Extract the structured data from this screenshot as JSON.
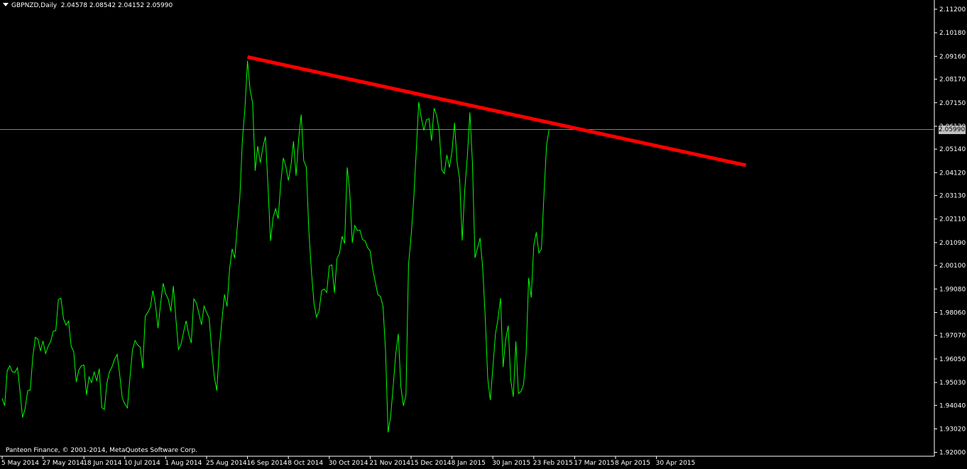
{
  "header": {
    "symbol": "GBPNZD,Daily",
    "ohlc": "2.04578 2.08542 2.04152 2.05990"
  },
  "copyright": "Panteon Finance, © 2001-2014, MetaQuotes Software Corp.",
  "current_price_label": "2.05990",
  "colors": {
    "background": "#000000",
    "price_line": "#00ff00",
    "trend_line": "#ff0000",
    "axis": "#ffffff",
    "current_price_line": "#808080"
  },
  "chart_data": {
    "type": "line",
    "title": "",
    "xlabel": "",
    "ylabel": "",
    "ylim": [
      1.9202,
      2.112
    ],
    "grid": false,
    "y_ticks": [
      "2.11200",
      "2.10180",
      "2.09160",
      "2.08170",
      "2.07150",
      "2.06130",
      "2.05140",
      "2.04120",
      "2.03130",
      "2.02110",
      "2.01090",
      "2.00100",
      "1.99080",
      "1.98060",
      "1.97070",
      "1.96050",
      "1.95030",
      "1.94040",
      "1.93020",
      "1.92000"
    ],
    "x_labels": [
      {
        "label": "5 May 2014",
        "x": 0
      },
      {
        "label": "27 May 2014",
        "x": 16
      },
      {
        "label": "18 Jun 2014",
        "x": 32
      },
      {
        "label": "10 Jul 2014",
        "x": 48
      },
      {
        "label": "1 Aug 2014",
        "x": 64
      },
      {
        "label": "25 Aug 2014",
        "x": 80
      },
      {
        "label": "16 Sep 2014",
        "x": 96
      },
      {
        "label": "8 Oct 2014",
        "x": 112
      },
      {
        "label": "30 Oct 2014",
        "x": 128
      },
      {
        "label": "21 Nov 2014",
        "x": 144
      },
      {
        "label": "15 Dec 2014",
        "x": 160
      },
      {
        "label": "8 Jan 2015",
        "x": 176
      },
      {
        "label": "30 Jan 2015",
        "x": 192
      },
      {
        "label": "23 Feb 2015",
        "x": 208
      },
      {
        "label": "17 Mar 2015",
        "x": 224
      },
      {
        "label": "8 Apr 2015",
        "x": 240
      },
      {
        "label": "30 Apr 2015",
        "x": 256
      }
    ],
    "series": [
      {
        "values": [
          1.9434,
          1.9402,
          1.9555,
          1.9575,
          1.9549,
          1.9547,
          1.9567,
          1.9465,
          1.9351,
          1.9391,
          1.9468,
          1.947,
          1.9613,
          1.9699,
          1.9691,
          1.964,
          1.9683,
          1.9628,
          1.966,
          1.9681,
          1.9725,
          1.9727,
          1.9862,
          1.9868,
          1.978,
          1.9752,
          1.9769,
          1.9661,
          1.9637,
          1.9505,
          1.9557,
          1.9575,
          1.9579,
          1.9449,
          1.9527,
          1.9503,
          1.9548,
          1.951,
          1.9563,
          1.9394,
          1.9386,
          1.95,
          1.955,
          1.9571,
          1.9604,
          1.9625,
          1.9537,
          1.9436,
          1.941,
          1.9393,
          1.9522,
          1.9645,
          1.9685,
          1.9666,
          1.9656,
          1.9564,
          1.979,
          1.9807,
          1.983,
          1.9901,
          1.9838,
          1.9738,
          1.9844,
          1.9933,
          1.9887,
          1.9864,
          1.9811,
          1.9921,
          1.9777,
          1.9646,
          1.9669,
          1.9722,
          1.977,
          1.9712,
          1.9674,
          1.9865,
          1.9847,
          1.9802,
          1.9753,
          1.9834,
          1.9806,
          1.9782,
          1.964,
          1.9528,
          1.9468,
          1.9656,
          1.9774,
          1.9884,
          1.9832,
          1.9995,
          2.0082,
          2.0042,
          2.0177,
          2.0304,
          2.0552,
          2.069,
          2.0897,
          2.0772,
          2.0715,
          2.042,
          2.0527,
          2.0455,
          2.052,
          2.0569,
          2.036,
          2.0116,
          2.0217,
          2.0256,
          2.0212,
          2.0364,
          2.0476,
          2.0439,
          2.0378,
          2.0442,
          2.0548,
          2.0399,
          2.0557,
          2.0664,
          2.0464,
          2.0437,
          2.016,
          1.9985,
          1.9848,
          1.9786,
          1.9814,
          1.9901,
          1.9908,
          1.9893,
          2.0008,
          2.0013,
          1.9891,
          2.0039,
          2.0063,
          2.0136,
          2.0105,
          2.0435,
          2.0329,
          2.0108,
          2.0183,
          2.0161,
          2.0163,
          2.0122,
          2.0117,
          2.0087,
          2.0073,
          1.9993,
          1.9938,
          1.9883,
          1.9876,
          1.9835,
          1.9644,
          1.9287,
          1.9356,
          1.9486,
          1.9627,
          1.9714,
          1.9485,
          1.9402,
          1.9449,
          2.0013,
          2.0136,
          2.029,
          2.0501,
          2.0718,
          2.065,
          2.0595,
          2.0641,
          2.0646,
          2.055,
          2.0691,
          2.066,
          2.0594,
          2.0424,
          2.0408,
          2.0489,
          2.0434,
          2.0504,
          2.0628,
          2.0457,
          2.0384,
          2.0118,
          2.0337,
          2.0479,
          2.0673,
          2.0457,
          2.0043,
          2.0086,
          2.0129,
          2.0002,
          1.9788,
          1.952,
          1.9427,
          1.9567,
          1.9712,
          1.9779,
          1.9868,
          1.957,
          1.9689,
          1.9749,
          1.9512,
          1.9441,
          1.9681,
          1.9455,
          1.9464,
          1.9494,
          1.9626,
          1.9956,
          1.9871,
          2.0096,
          2.0154,
          2.0064,
          2.0081,
          2.0319,
          2.053,
          2.0599
        ]
      }
    ],
    "trend_line": {
      "start": {
        "index": 96,
        "value": 2.0913
      },
      "end": {
        "index": 291,
        "value": 2.0444
      }
    },
    "current_price": 2.0599
  }
}
